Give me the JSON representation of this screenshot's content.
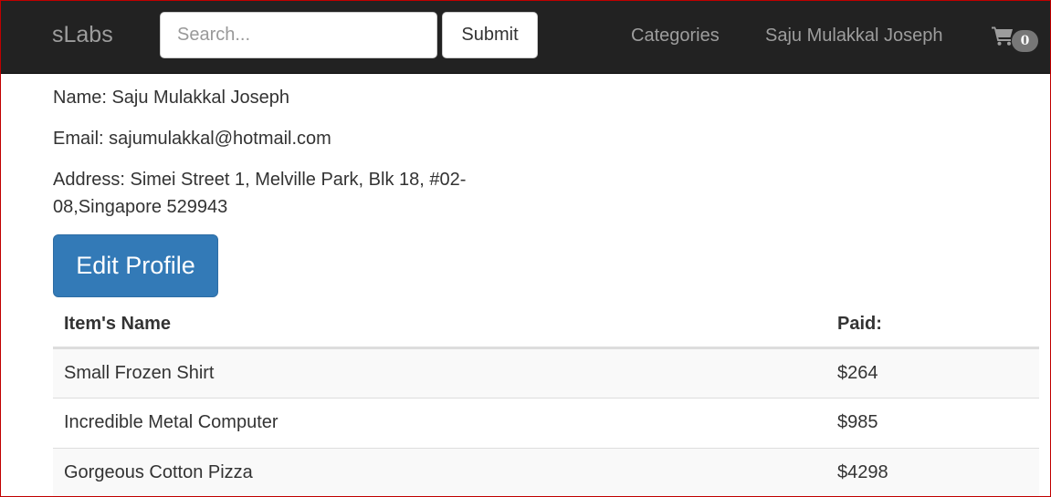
{
  "navbar": {
    "brand": "sLabs",
    "search_placeholder": "Search...",
    "submit_label": "Submit",
    "categories_label": "Categories",
    "user_label": "Saju Mulakkal Joseph",
    "cart_icon": "shopping-cart-icon",
    "cart_count": "0"
  },
  "profile": {
    "name_line": "Name: Saju Mulakkal Joseph",
    "email_line": "Email: sajumulakkal@hotmail.com",
    "address_line": "Address: Simei Street 1, Melville Park, Blk 18, #02-08,Singapore 529943",
    "edit_label": "Edit Profile"
  },
  "orders": {
    "headers": [
      "Item's Name",
      "Paid:"
    ],
    "rows": [
      {
        "name": "Small Frozen Shirt",
        "paid": "$264"
      },
      {
        "name": "Incredible Metal Computer",
        "paid": "$985"
      },
      {
        "name": "Gorgeous Cotton Pizza",
        "paid": "$4298"
      }
    ]
  },
  "colors": {
    "navbar_bg": "#222222",
    "primary": "#337ab7",
    "badge": "#777777"
  }
}
